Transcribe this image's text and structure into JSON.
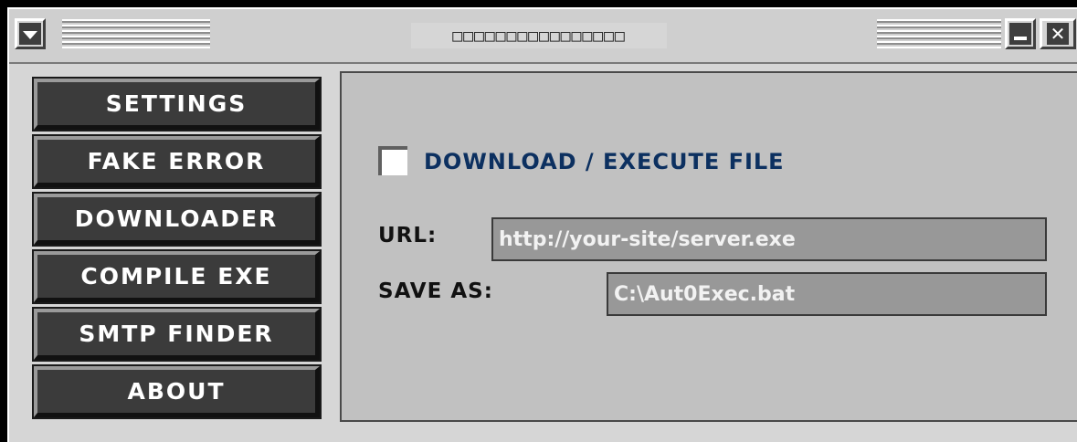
{
  "window": {
    "title": "□□□□□□□□□□□□□□□□",
    "menu_icon": "dropdown-triangle-icon",
    "minimize_icon": "minimize-icon",
    "close_icon": "close-icon",
    "close_glyph": "✕"
  },
  "nav": {
    "items": [
      {
        "label": "SETTINGS"
      },
      {
        "label": "FAKE ERROR"
      },
      {
        "label": "DOWNLOADER"
      },
      {
        "label": "COMPILE EXE"
      },
      {
        "label": "SMTP FINDER"
      },
      {
        "label": "ABOUT"
      }
    ]
  },
  "downloader": {
    "checkbox_label": "DOWNLOAD / EXECUTE FILE",
    "checkbox_checked": false,
    "url_label": "URL:",
    "url_value": "http://your-site/server.exe",
    "saveas_label": "SAVE AS:",
    "saveas_value": "C:\\Aut0Exec.bat"
  },
  "colors": {
    "accent_text": "#0c3060",
    "button_bg": "#3b3b3b",
    "panel_bg": "#c1c1c1",
    "field_bg": "#989898"
  }
}
